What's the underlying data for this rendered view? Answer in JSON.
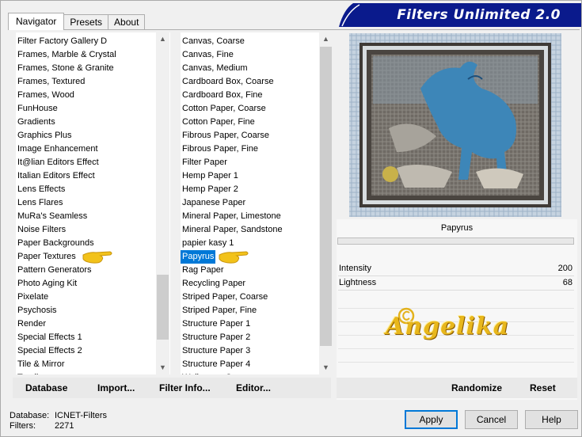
{
  "tabs": [
    "Navigator",
    "Presets",
    "About"
  ],
  "banner_title": "Filters Unlimited 2.0",
  "categories": [
    "Filter Factory Gallery D",
    "Frames, Marble & Crystal",
    "Frames, Stone & Granite",
    "Frames, Textured",
    "Frames, Wood",
    "FunHouse",
    "Gradients",
    "Graphics Plus",
    "Image Enhancement",
    "It@lian Editors Effect",
    "Italian Editors Effect",
    "Lens Effects",
    "Lens Flares",
    "MuRa's Seamless",
    "Noise Filters",
    "Paper Backgrounds",
    "Paper Textures",
    "Pattern Generators",
    "Photo Aging Kit",
    "Pixelate",
    "Psychosis",
    "Render",
    "Special Effects 1",
    "Special Effects 2",
    "Tile & Mirror",
    "Toadies"
  ],
  "filters": [
    "Canvas, Coarse",
    "Canvas, Fine",
    "Canvas, Medium",
    "Cardboard Box, Coarse",
    "Cardboard Box, Fine",
    "Cotton Paper, Coarse",
    "Cotton Paper, Fine",
    "Fibrous Paper, Coarse",
    "Fibrous Paper, Fine",
    "Filter Paper",
    "Hemp Paper 1",
    "Hemp Paper 2",
    "Japanese Paper",
    "Mineral Paper, Limestone",
    "Mineral Paper, Sandstone",
    "papier kasy 1",
    "Papyrus",
    "Rag Paper",
    "Recycling Paper",
    "Striped Paper, Coarse",
    "Striped Paper, Fine",
    "Structure Paper 1",
    "Structure Paper 2",
    "Structure Paper 3",
    "Structure Paper 4",
    "Wallpaper, Coarse"
  ],
  "selected_filter_index": 16,
  "filter_name": "Papyrus",
  "params": [
    {
      "label": "Intensity",
      "value": "200"
    },
    {
      "label": "Lightness",
      "value": "68"
    }
  ],
  "watermark": "Angelika",
  "buttons_left": [
    "Database",
    "Import...",
    "Filter Info...",
    "Editor..."
  ],
  "buttons_right": [
    "Randomize",
    "Reset"
  ],
  "status": {
    "database_label": "Database:",
    "database_value": "ICNET-Filters",
    "filters_label": "Filters:",
    "filters_value": "2271"
  },
  "dialog_buttons": {
    "apply": "Apply",
    "cancel": "Cancel",
    "help": "Help"
  },
  "colors": {
    "banner": "#0a1a8c",
    "selection": "#0078d7",
    "hand": "#f2c21a"
  }
}
